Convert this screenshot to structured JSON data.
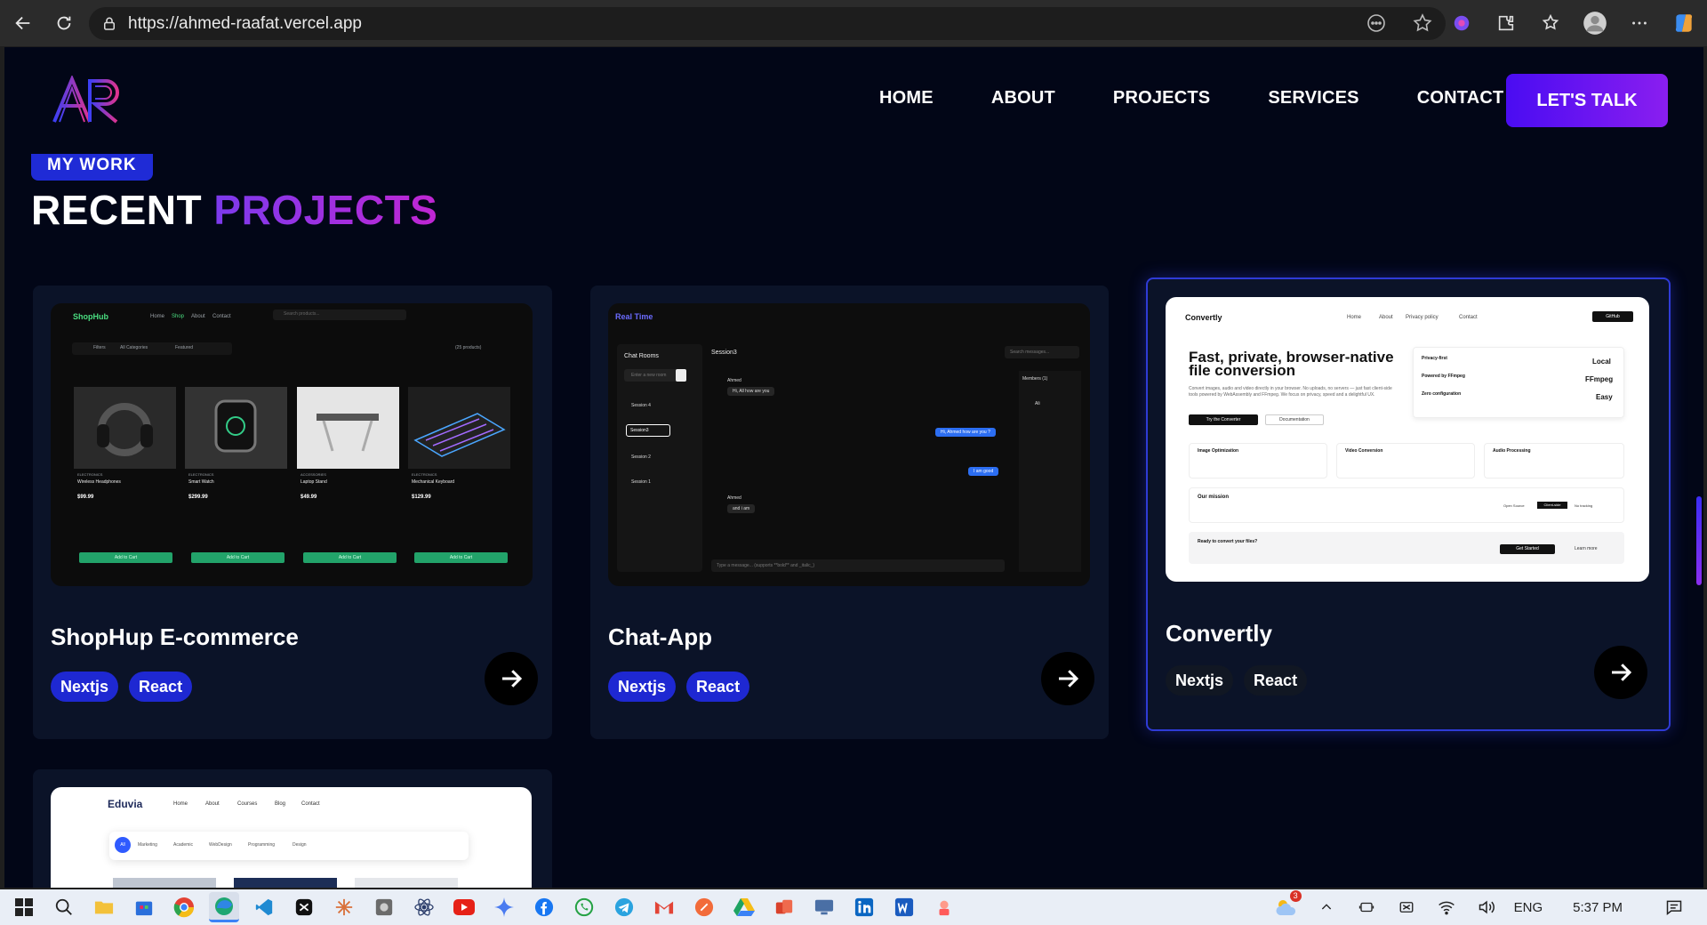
{
  "browser": {
    "url": "https://ahmed-raafat.vercel.app"
  },
  "site": {
    "nav": [
      "HOME",
      "ABOUT",
      "PROJECTS",
      "SERVICES",
      "CONTACT"
    ],
    "cta": "LET'S TALK",
    "badge": "MY WORK",
    "title_plain": "RECENT",
    "title_accent": "PROJECTS"
  },
  "projects": [
    {
      "title": "ShopHup E-commerce",
      "tags": [
        "Nextjs",
        "React"
      ],
      "mock": {
        "brand": "ShopHub",
        "links": [
          "Home",
          "Shop",
          "About",
          "Contact"
        ],
        "search": "Search products...",
        "filters": "Filters",
        "categories": "All Categories",
        "sort": "Featured",
        "count": "(25 products)",
        "products": [
          {
            "category": "ELECTRONICS",
            "name": "Wireless Headphones",
            "price": "$99.99"
          },
          {
            "category": "ELECTRONICS",
            "name": "Smart Watch",
            "price": "$299.99"
          },
          {
            "category": "ACCESSORIES",
            "name": "Laptop Stand",
            "price": "$49.99"
          },
          {
            "category": "ELECTRONICS",
            "name": "Mechanical Keyboard",
            "price": "$129.99"
          }
        ],
        "add_to_cart": "Add to Cart"
      }
    },
    {
      "title": "Chat-App",
      "tags": [
        "Nextjs",
        "React"
      ],
      "mock": {
        "brand": "Real Time",
        "rooms_title": "Chat Rooms",
        "new_room": "Enter a new room",
        "rooms": [
          "Session 4",
          "Session3",
          "Session 2",
          "Session 1"
        ],
        "active_room": "Session3",
        "search": "Search messages...",
        "members": "Members (1)",
        "member": "Ali",
        "messages": [
          {
            "from": "Ahmed",
            "text": "Hi, All how are you"
          },
          {
            "from": "Ali",
            "text": "Hi, Ahmed how are you ?"
          },
          {
            "from": "Ali",
            "text": "I am good"
          },
          {
            "from": "Ahmed",
            "text": "and i am"
          }
        ],
        "composer": "Type a message... (supports **bold** and _italic_)"
      }
    },
    {
      "title": "Convertly",
      "tags": [
        "Nextjs",
        "React"
      ],
      "mock": {
        "brand": "Convertly",
        "links": [
          "Home",
          "About",
          "Privacy policy",
          "Contact"
        ],
        "github": "GitHub",
        "headline": "Fast, private, browser-native file conversion",
        "sub": "Convert images, audio and video directly in your browser. No uploads, no servers — just fast client-side tools powered by WebAssembly and FFmpeg. We focus on privacy, speed and a delightful UX.",
        "try_btn": "Try the Converter",
        "docs_btn": "Documentation",
        "features": [
          {
            "title": "Privacy-first",
            "value": "Local"
          },
          {
            "title": "Powered by FFmpeg",
            "value": "FFmpeg"
          },
          {
            "title": "Zero configuration",
            "value": "Easy"
          }
        ],
        "cards": [
          "Image Optimization",
          "Video Conversion",
          "Audio Processing"
        ],
        "mission": "Our mission",
        "mission_tags": [
          "Open Source",
          "Client-side",
          "No tracking"
        ],
        "ready": "Ready to convert your files?",
        "get_started": "Get Started",
        "learn_more": "Learn more"
      }
    },
    {
      "title": "Eduvia",
      "mock": {
        "brand": "Eduvia",
        "links": [
          "Home",
          "About",
          "Courses",
          "Blog",
          "Contact"
        ],
        "chips": [
          "All",
          "Marketing",
          "Academic",
          "WebDesign",
          "Programming",
          "Design"
        ]
      }
    }
  ],
  "taskbar": {
    "lang": "ENG",
    "time": "5:37 PM",
    "weather_badge": "3"
  },
  "colors": {
    "page_bg": "#020617",
    "card_bg": "#0b1328",
    "tag_blue": "#1e28d2",
    "accent_purple": "#8a1ef0"
  }
}
